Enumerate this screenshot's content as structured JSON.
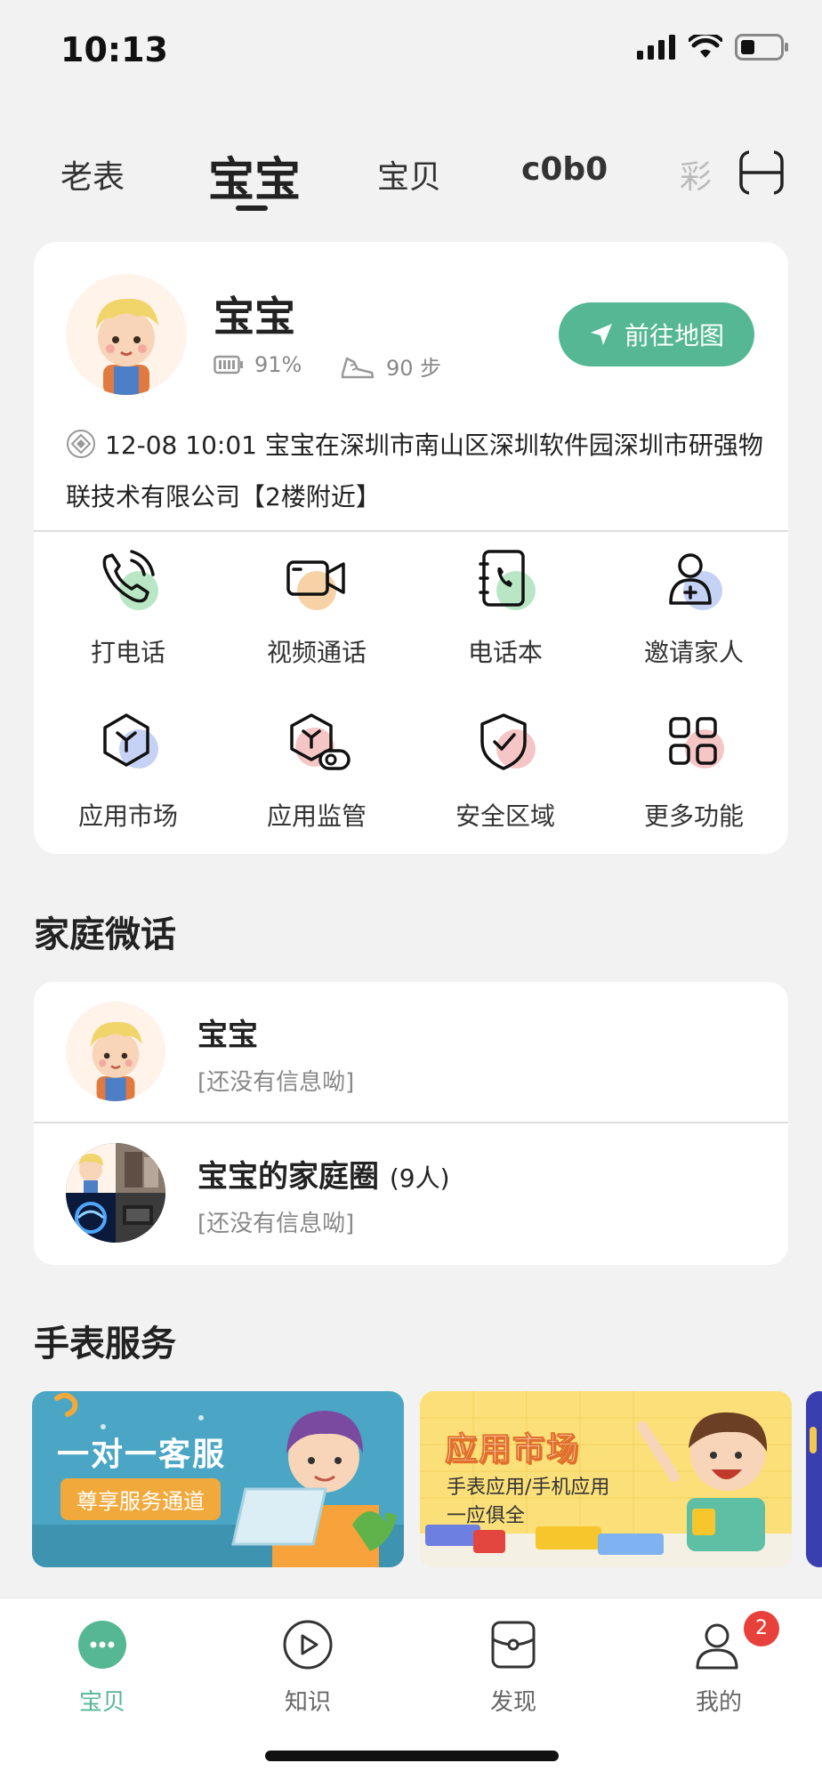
{
  "status_bar": {
    "time": "10:13"
  },
  "top_tabs": {
    "items": [
      "老表",
      "宝宝",
      "宝贝",
      "c0b0",
      "彩"
    ],
    "active_index": 1
  },
  "watch": {
    "name": "宝宝",
    "battery": "91%",
    "steps": "90 步",
    "map_button": "前往地图",
    "location": "12-08 10:01 宝宝在深圳市南山区深圳软件园深圳市研强物联技术有限公司【2楼附近】"
  },
  "functions": [
    {
      "label": "打电话",
      "icon": "phone-icon",
      "accent": "#b9e7c5"
    },
    {
      "label": "视频通话",
      "icon": "video-camera-icon",
      "accent": "#f7d2a6"
    },
    {
      "label": "电话本",
      "icon": "phonebook-icon",
      "accent": "#b9e7c5"
    },
    {
      "label": "邀请家人",
      "icon": "invite-family-icon",
      "accent": "#c6d2f5"
    },
    {
      "label": "应用市场",
      "icon": "app-market-icon",
      "accent": "#c6d2f5"
    },
    {
      "label": "应用监管",
      "icon": "app-supervision-icon",
      "accent": "#f6c6c6"
    },
    {
      "label": "安全区域",
      "icon": "shield-icon",
      "accent": "#f6c6c6"
    },
    {
      "label": "更多功能",
      "icon": "grid-icon",
      "accent": "#f6c6c6"
    }
  ],
  "family_chat": {
    "title": "家庭微话",
    "items": [
      {
        "name": "宝宝",
        "count": "",
        "message": "[还没有信息呦]"
      },
      {
        "name": "宝宝的家庭圈",
        "count": "(9人)",
        "message": "[还没有信息呦]"
      }
    ]
  },
  "services": {
    "title": "手表服务",
    "banners": [
      {
        "title": "一对一客服",
        "subtitle": "尊享服务通道",
        "color": "#4aa6c4"
      },
      {
        "title": "应用市场",
        "subtitle": "手表应用/手机应用",
        "subtitle2": "一应俱全",
        "color": "#fbe07a"
      }
    ]
  },
  "bottom_nav": {
    "items": [
      {
        "label": "宝贝",
        "icon": "chat-bubble-icon"
      },
      {
        "label": "知识",
        "icon": "play-circle-icon"
      },
      {
        "label": "发现",
        "icon": "discover-icon"
      },
      {
        "label": "我的",
        "icon": "profile-icon",
        "badge": "2"
      }
    ],
    "active_index": 0
  },
  "colors": {
    "accent": "#55b794",
    "badge": "#e8413b"
  }
}
